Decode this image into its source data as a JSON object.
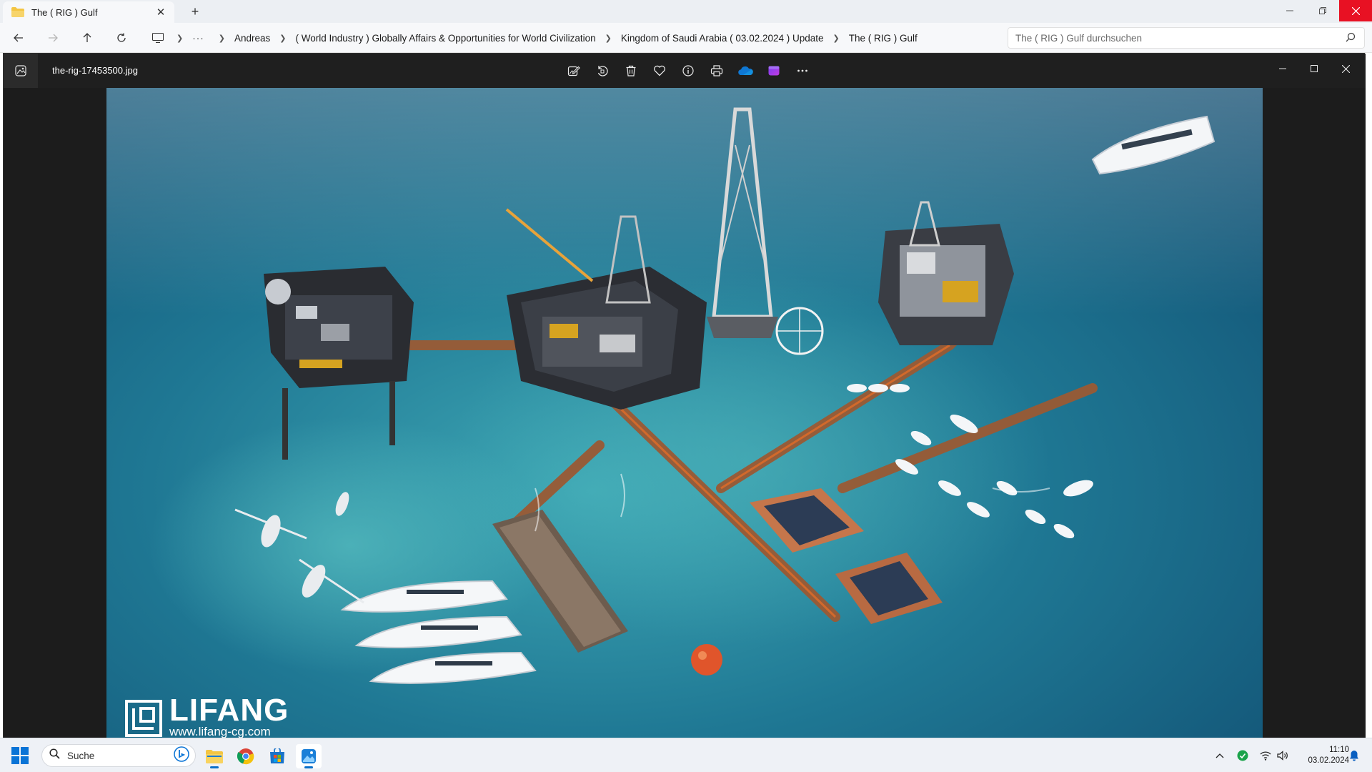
{
  "explorer": {
    "tab": {
      "title": "The ( RIG ) Gulf",
      "icon": "folder-icon"
    },
    "nav": {
      "back": "back-arrow-icon",
      "forward": "forward-arrow-icon",
      "up": "up-arrow-icon",
      "refresh": "refresh-icon"
    },
    "breadcrumbs": {
      "more": "···",
      "items": [
        "Andreas",
        "( World Industry ) Globally Affairs & Opportunities for World Civilization",
        "Kingdom of Saudi Arabia ( 03.02.2024 ) Update",
        "The ( RIG ) Gulf"
      ]
    },
    "search_placeholder": "The ( RIG ) Gulf durchsuchen"
  },
  "photos": {
    "filename": "the-rig-17453500.jpg",
    "toolbar": [
      "edit-icon",
      "rotate-icon",
      "delete-icon",
      "favorite-icon",
      "info-icon",
      "print-icon",
      "onedrive-icon",
      "clipchamp-icon",
      "more-icon"
    ],
    "watermark": {
      "brand": "LIFANG",
      "url": "www.lifang-cg.com"
    }
  },
  "taskbar": {
    "search_label": "Suche",
    "apps": [
      "file-explorer-icon",
      "chrome-icon",
      "store-icon",
      "photos-icon"
    ],
    "time": "11:10",
    "date": "03.02.2024"
  },
  "colors": {
    "sea_light": "#3ea7b4",
    "sea_deep": "#0f4a6e",
    "accent": "#0a74d6",
    "close_red": "#e81123"
  }
}
